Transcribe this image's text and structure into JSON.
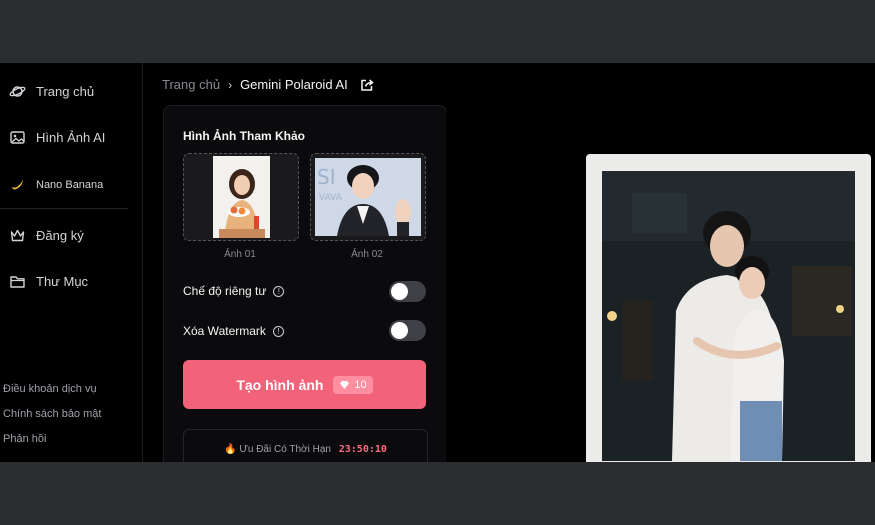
{
  "sidebar": {
    "items": [
      {
        "label": "Trang chủ",
        "icon": "planet-icon"
      },
      {
        "label": "Hình Ảnh AI",
        "icon": "image-icon"
      },
      {
        "label": "Nano Banana",
        "icon": "banana-icon"
      },
      {
        "label": "Đăng ký",
        "icon": "crown-icon"
      },
      {
        "label": "Thư Mục",
        "icon": "folder-icon"
      }
    ],
    "footer_links": [
      "Điều khoản dịch vụ",
      "Chính sách bảo mật",
      "Phản hồi"
    ]
  },
  "breadcrumb": {
    "home": "Trang chủ",
    "separator": "›",
    "current": "Gemini Polaroid AI"
  },
  "panel": {
    "title": "Hình Ảnh Tham Khảo",
    "images": [
      {
        "caption": "Ảnh 01"
      },
      {
        "caption": "Ảnh 02"
      }
    ],
    "private_mode": {
      "label": "Chế độ riêng tư",
      "on": false
    },
    "remove_watermark": {
      "label": "Xóa Watermark",
      "on": false
    },
    "generate": {
      "label": "Tạo hình ảnh",
      "cost": "10"
    },
    "promo": {
      "emoji": "🔥",
      "label": "Ưu Đãi Có Thời Hạn",
      "timer": "23:50:10"
    }
  },
  "colors": {
    "accent": "#f2637a",
    "background": "#000000",
    "chrome": "#2b2d30"
  }
}
